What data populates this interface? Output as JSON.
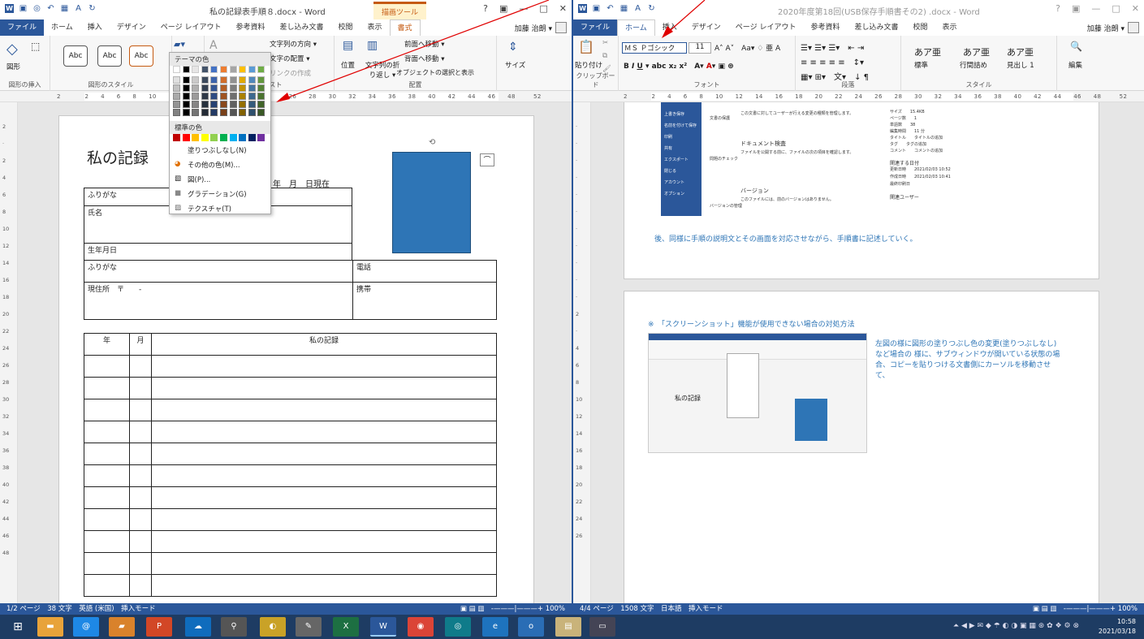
{
  "left": {
    "title": "私の記録表手順８.docx - Word",
    "ctx_tool": "描画ツール",
    "tabs": [
      "ファイル",
      "ホーム",
      "挿入",
      "デザイン",
      "ページ レイアウト",
      "参考資料",
      "差し込み文書",
      "校閲",
      "表示",
      "書式"
    ],
    "user": "加藤 治朗 ▾",
    "ribbon": {
      "insert_shape": "図形の挿入",
      "shape_style": "図形のスタイル",
      "style_label": "Abc",
      "text_group": "テキスト",
      "text_direction": "文字列の方向 ▾",
      "text_align": "文字の配置 ▾",
      "link_create": "リンクの作成",
      "arrange": "配置",
      "position": "位置",
      "wrap": "文字列の折り返し ▾",
      "bring_front": "前面へ移動 ▾",
      "send_back": "背面へ移動 ▾",
      "selection_pane": "オブジェクトの選択と表示",
      "size": "サイズ"
    },
    "menu": {
      "theme_colors": "テーマの色",
      "standard_colors": "標準の色",
      "no_fill": "塗りつぶしなし(N)",
      "more_colors": "その他の色(M)...",
      "picture": "図(P)...",
      "gradient": "グラデーション(G)",
      "texture": "テクスチャ(T)"
    },
    "doc": {
      "heading": "私の記録",
      "date": "年　月　日現在",
      "furigana": "ふりがな",
      "name": "氏名",
      "birth": "生年月日",
      "furigana2": "ふりがな",
      "phone": "電話",
      "address": "現住所　〒　　-",
      "mobile": "携帯",
      "col_year": "年",
      "col_month": "月",
      "col_record": "私の記録"
    },
    "status": "1/2 ページ　38 文字　英語 (米国)　挿入モード",
    "zoom": "100%"
  },
  "right": {
    "title": "2020年度第18回(USB保存手順書その2) .docx - Word",
    "tabs": [
      "ファイル",
      "ホーム",
      "挿入",
      "デザイン",
      "ページ レイアウト",
      "参考資料",
      "差し込み文書",
      "校閲",
      "表示"
    ],
    "user": "加藤 治朗 ▾",
    "ribbon": {
      "paste": "貼り付け",
      "clipboard": "クリップボード",
      "font_name": "ＭＳ Ｐゴシック",
      "font_size": "11",
      "font_group": "フォント",
      "paragraph": "段落",
      "styles": "スタイル",
      "style1": "あア亜",
      "style1_label": "標準",
      "style2": "あア亜",
      "style2_label": "行間詰め",
      "style3": "あア亜",
      "style3_label": "見出し 1",
      "edit": "編集"
    },
    "page1": {
      "info_items": [
        "上書き保存",
        "名前を付けて保存",
        "印刷",
        "共有",
        "エクスポート",
        "閉じる",
        "アカウント",
        "オプション"
      ],
      "protect": "文書の保護",
      "protect_desc": "この文書に対してユーザーが行える変更の種類を管理します。",
      "inspect_title": "ドキュメント検査",
      "inspect_desc": "ファイルを公開する前に、ファイルの次の項目を確認します。",
      "inspect_label": "問題のチェック",
      "version_title": "バージョン",
      "version_desc": "このファイルには、前のバージョンはありません。",
      "version_label": "バージョンの管理",
      "props": [
        "サイズ",
        "15.4KB",
        "ページ数",
        "1",
        "単語数",
        "38",
        "編集時間",
        "11 分",
        "タイトル",
        "タイトルの追加",
        "タグ",
        "タグの追加",
        "コメント",
        "コメントの追加"
      ],
      "related_dates": "関連する日付",
      "dates": [
        "更新日時",
        "2021/02/03 10:52",
        "作成日時",
        "2021/02/03 10:41",
        "最終印刷日"
      ],
      "related_user": "関連ユーザー",
      "body": "後、同様に手順の説明文とその画面を対応させながら、手順書に記述していく。"
    },
    "page2": {
      "note": "※　「スクリーンショット」機能が使用できない場合の対処方法",
      "desc": "左図の様に図形の塗りつぶし色の変更(塗りつぶしなし)など場合の 様に、サブウィンドウが開いている状態の場合、コピーを貼りつける文書側にカーソルを移動させて、"
    },
    "status": "4/4 ページ　1508 文字　日本語　挿入モード",
    "zoom": "100%"
  },
  "taskbar": {
    "time": "10:58",
    "date": "2021/03/18"
  },
  "colors": {
    "word_blue": "#2b579a",
    "accent_orange": "#c55a11",
    "shape_blue": "#2e75b6",
    "annot_red": "#e00000"
  }
}
